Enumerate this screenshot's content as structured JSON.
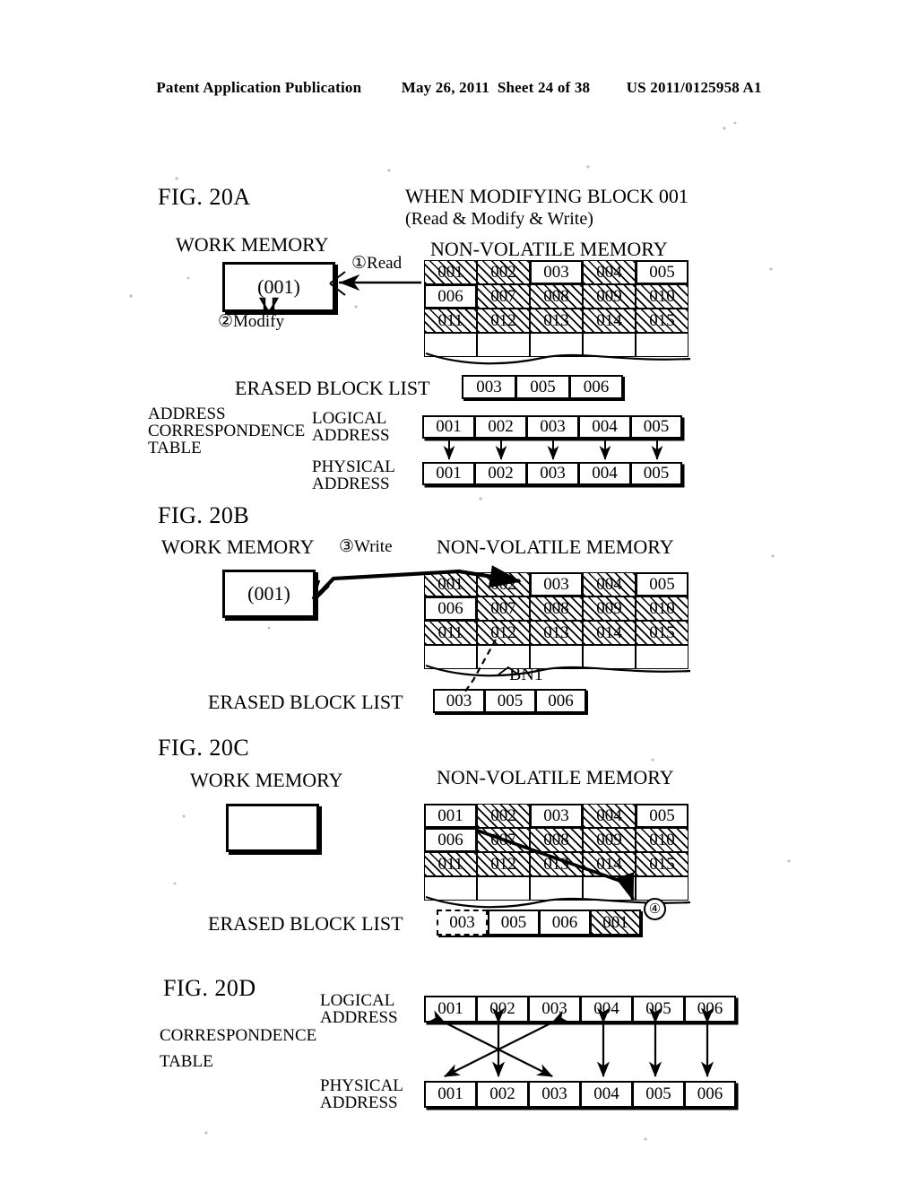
{
  "header": {
    "publication": "Patent Application Publication",
    "date": "May 26, 2011",
    "sheet": "Sheet 24 of 38",
    "number": "US 2011/0125958 A1"
  },
  "figures": [
    {
      "id": "fig-20a",
      "title": "FIG. 20A",
      "caption_line1": "WHEN MODIFYING BLOCK 001",
      "caption_line2": "(Read & Modify & Write)",
      "work_memory_label": "WORK MEMORY",
      "work_memory_value": "(001)",
      "nvm_label": "NON-VOLATILE MEMORY",
      "step_read": "①Read",
      "step_modify": "②Modify",
      "nvm_grid": {
        "rows": [
          [
            {
              "v": "001",
              "state": "used"
            },
            {
              "v": "002",
              "state": "used"
            },
            {
              "v": "003",
              "state": "erased"
            },
            {
              "v": "004",
              "state": "used"
            },
            {
              "v": "005",
              "state": "erased"
            }
          ],
          [
            {
              "v": "006",
              "state": "erased"
            },
            {
              "v": "007",
              "state": "used"
            },
            {
              "v": "008",
              "state": "used"
            },
            {
              "v": "009",
              "state": "used"
            },
            {
              "v": "010",
              "state": "used"
            }
          ],
          [
            {
              "v": "011",
              "state": "used"
            },
            {
              "v": "012",
              "state": "used"
            },
            {
              "v": "013",
              "state": "used"
            },
            {
              "v": "014",
              "state": "used"
            },
            {
              "v": "015",
              "state": "used"
            }
          ],
          [
            {
              "v": "",
              "state": "blank"
            },
            {
              "v": "",
              "state": "blank"
            },
            {
              "v": "",
              "state": "blank"
            },
            {
              "v": "",
              "state": "blank"
            },
            {
              "v": "",
              "state": "blank"
            }
          ]
        ]
      },
      "erased_block_list_label": "ERASED BLOCK LIST",
      "erased_block_list": [
        {
          "v": "003",
          "state": "normal"
        },
        {
          "v": "005",
          "state": "normal"
        },
        {
          "v": "006",
          "state": "normal"
        }
      ],
      "table_label_line1": "ADDRESS",
      "table_label_line2": "CORRESPONDENCE",
      "table_label_line3": "TABLE",
      "logical_label_line1": "LOGICAL",
      "logical_label_line2": "ADDRESS",
      "physical_label_line1": "PHYSICAL",
      "physical_label_line2": "ADDRESS",
      "logical_addresses": [
        "001",
        "002",
        "003",
        "004",
        "005"
      ],
      "physical_addresses": [
        "001",
        "002",
        "003",
        "004",
        "005"
      ]
    },
    {
      "id": "fig-20b",
      "title": "FIG. 20B",
      "work_memory_label": "WORK MEMORY",
      "work_memory_value": "(001)",
      "nvm_label": "NON-VOLATILE MEMORY",
      "step_write": "③Write",
      "pointer_label": "BN1",
      "nvm_grid": {
        "rows": [
          [
            {
              "v": "001",
              "state": "used"
            },
            {
              "v": "002",
              "state": "used"
            },
            {
              "v": "003",
              "state": "erased"
            },
            {
              "v": "004",
              "state": "used"
            },
            {
              "v": "005",
              "state": "erased"
            }
          ],
          [
            {
              "v": "006",
              "state": "erased"
            },
            {
              "v": "007",
              "state": "used"
            },
            {
              "v": "008",
              "state": "used"
            },
            {
              "v": "009",
              "state": "used"
            },
            {
              "v": "010",
              "state": "used"
            }
          ],
          [
            {
              "v": "011",
              "state": "used"
            },
            {
              "v": "012",
              "state": "used"
            },
            {
              "v": "013",
              "state": "used"
            },
            {
              "v": "014",
              "state": "used"
            },
            {
              "v": "015",
              "state": "used"
            }
          ],
          [
            {
              "v": "",
              "state": "blank"
            },
            {
              "v": "",
              "state": "blank"
            },
            {
              "v": "",
              "state": "blank"
            },
            {
              "v": "",
              "state": "blank"
            },
            {
              "v": "",
              "state": "blank"
            }
          ]
        ]
      },
      "erased_block_list_label": "ERASED BLOCK LIST",
      "erased_block_list": [
        {
          "v": "003",
          "state": "normal"
        },
        {
          "v": "005",
          "state": "normal"
        },
        {
          "v": "006",
          "state": "normal"
        }
      ]
    },
    {
      "id": "fig-20c",
      "title": "FIG. 20C",
      "work_memory_label": "WORK MEMORY",
      "work_memory_value": "",
      "nvm_label": "NON-VOLATILE MEMORY",
      "step_add": "④",
      "nvm_grid": {
        "rows": [
          [
            {
              "v": "001",
              "state": "used-erased"
            },
            {
              "v": "002",
              "state": "used"
            },
            {
              "v": "003",
              "state": "erased"
            },
            {
              "v": "004",
              "state": "used"
            },
            {
              "v": "005",
              "state": "erased"
            }
          ],
          [
            {
              "v": "006",
              "state": "erased"
            },
            {
              "v": "007",
              "state": "used"
            },
            {
              "v": "008",
              "state": "used"
            },
            {
              "v": "009",
              "state": "used"
            },
            {
              "v": "010",
              "state": "used"
            }
          ],
          [
            {
              "v": "011",
              "state": "used"
            },
            {
              "v": "012",
              "state": "used"
            },
            {
              "v": "013",
              "state": "used"
            },
            {
              "v": "014",
              "state": "used"
            },
            {
              "v": "015",
              "state": "used"
            }
          ],
          [
            {
              "v": "",
              "state": "blank"
            },
            {
              "v": "",
              "state": "blank"
            },
            {
              "v": "",
              "state": "blank"
            },
            {
              "v": "",
              "state": "blank"
            },
            {
              "v": "",
              "state": "blank"
            }
          ]
        ]
      },
      "erased_block_list_label": "ERASED BLOCK LIST",
      "erased_block_list": [
        {
          "v": "003",
          "state": "dashed"
        },
        {
          "v": "005",
          "state": "normal"
        },
        {
          "v": "006",
          "state": "normal"
        },
        {
          "v": "001",
          "state": "used"
        }
      ]
    },
    {
      "id": "fig-20d",
      "title": "FIG. 20D",
      "table_label_line1": "CORRESPONDENCE",
      "table_label_line2": "TABLE",
      "logical_label_line1": "LOGICAL",
      "logical_label_line2": "ADDRESS",
      "physical_label_line1": "PHYSICAL",
      "physical_label_line2": "ADDRESS",
      "logical_addresses": [
        "001",
        "002",
        "003",
        "004",
        "005",
        "006"
      ],
      "physical_addresses": [
        "001",
        "002",
        "003",
        "004",
        "005",
        "006"
      ],
      "mappings": [
        {
          "logical": "001",
          "physical": "003",
          "kind": "crossed"
        },
        {
          "logical": "002",
          "physical": "002",
          "kind": "direct"
        },
        {
          "logical": "003",
          "physical": "001",
          "kind": "crossed"
        },
        {
          "logical": "004",
          "physical": "004",
          "kind": "direct"
        },
        {
          "logical": "005",
          "physical": "005",
          "kind": "direct"
        },
        {
          "logical": "006",
          "physical": "006",
          "kind": "direct"
        }
      ]
    }
  ],
  "colors": {
    "ink": "#000000",
    "page": "#ffffff"
  }
}
